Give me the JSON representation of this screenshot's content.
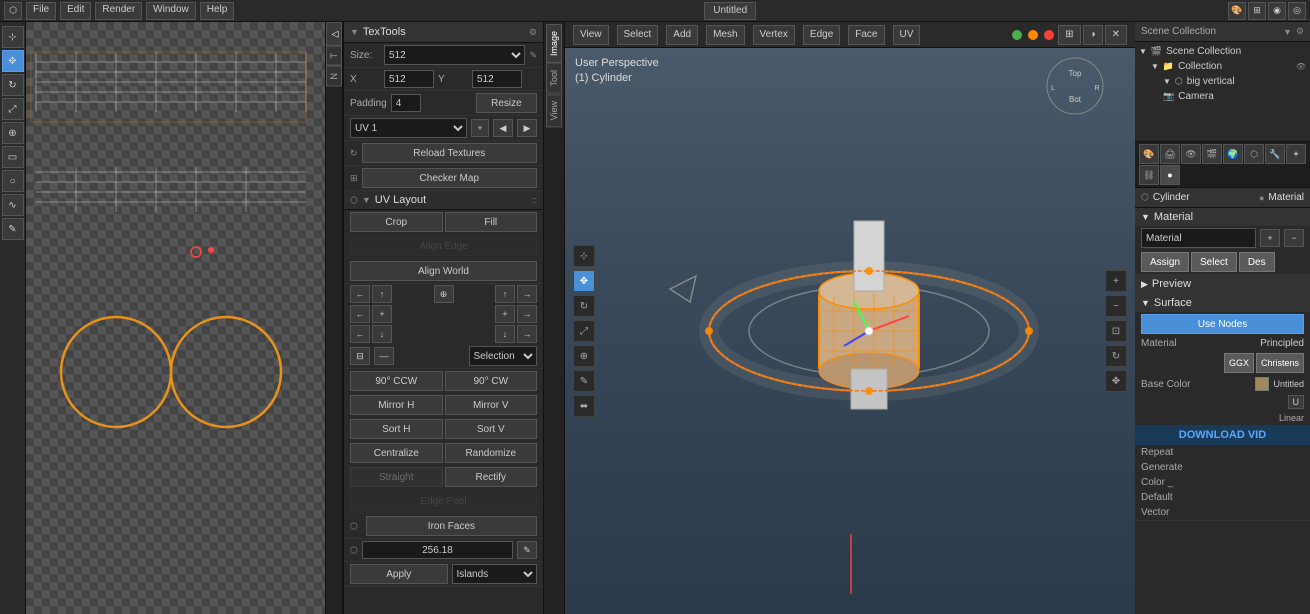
{
  "topbar": {
    "title": "Untitled",
    "buttons": [
      "Select",
      "Add",
      "Mesh",
      "Vertex",
      "Edge",
      "Face",
      "UV"
    ]
  },
  "tex_tools": {
    "header": "TexTools",
    "size_label": "Size:",
    "size_value": "512",
    "x_label": "X",
    "x_value": "512",
    "y_label": "Y",
    "y_value": "512",
    "padding_label": "Padding",
    "padding_value": "4",
    "resize_btn": "Resize",
    "uv_label": "UV 1",
    "reload_btn": "Reload Textures",
    "checker_btn": "Checker Map"
  },
  "uv_layout": {
    "header": "UV Layout",
    "crop_btn": "Crop",
    "fill_btn": "Fill",
    "align_edge_btn": "Align Edge",
    "align_world_btn": "Align World",
    "rotate_ccw": "90° CCW",
    "rotate_cw": "90° CW",
    "mirror_h": "Mirror H",
    "mirror_v": "Mirror V",
    "sort_h": "Sort H",
    "sort_v": "Sort V",
    "centralize_btn": "Centralize",
    "randomize_btn": "Randomize",
    "straight_btn": "Straight",
    "rectify_btn": "Rectify",
    "edge_peel_btn": "Edge Peel",
    "iron_faces_btn": "Iron Faces",
    "value_display": "256.18",
    "apply_btn": "Apply",
    "islands_select": "Islands",
    "selection_select": "Selection"
  },
  "viewport": {
    "perspective_label": "User Perspective",
    "object_label": "(1) Cylinder"
  },
  "outliner": {
    "header": "Scene Collection",
    "items": [
      {
        "name": "Collection",
        "indent": 0,
        "icon": "▶"
      },
      {
        "name": "big vertical",
        "indent": 1,
        "icon": "▼"
      },
      {
        "name": "Camera",
        "indent": 1,
        "icon": "📷"
      }
    ]
  },
  "properties": {
    "header": "Material",
    "cylinder_label": "Cylinder",
    "material_label": "Material",
    "mat_label": "Material",
    "assign_btn": "Assign",
    "select_btn": "Select",
    "deselect_btn": "Des",
    "preview_label": "Preview",
    "surface_label": "Surface",
    "use_nodes_btn": "Use Nodes",
    "surface_type": "Principled",
    "ggx_label": "GGX",
    "christens_label": "Christens",
    "base_color_label": "Base Color",
    "base_color_value": "Untitled",
    "u_label": "U",
    "linear_label": "Linear",
    "download_banner": "DOWNLOAD VID",
    "repeat_label": "Repeat",
    "generate_label": "Generate",
    "color_label": "Color _",
    "default_label": "Default",
    "vector_label": "Vector"
  },
  "icons": {
    "arrow_left": "◀",
    "arrow_right": "▶",
    "arrow_up": "▲",
    "arrow_down": "▼",
    "rotate": "↻",
    "expand": "⊞",
    "collapse": "⊟",
    "move": "✥",
    "cursor": "⊹",
    "select_box": "▭",
    "circle": "○",
    "lasso": "∿",
    "grab": "☽",
    "scale": "⤢",
    "annotate": "✎",
    "measure": "⬌",
    "transform": "⊕",
    "gear": "⚙",
    "material": "●",
    "camera": "📷",
    "light": "💡",
    "scene": "🎬",
    "render": "🎨",
    "object": "⬡",
    "modifier": "⊕",
    "particles": "✦",
    "constraints": "⛓",
    "data": "⬡",
    "shader": "◑",
    "world": "🌍",
    "plus": "+",
    "minus": "-",
    "dot": "•",
    "x_close": "✕",
    "pin": "📌",
    "shield": "🛡",
    "sphere": "⬤",
    "tri": "▷",
    "quad": "□"
  },
  "colors": {
    "accent_blue": "#4a90d9",
    "active_orange": "#ff8c00",
    "green_dot": "#4caf50",
    "red_dot": "#f44336",
    "yellow_dot": "#ffeb3b"
  }
}
